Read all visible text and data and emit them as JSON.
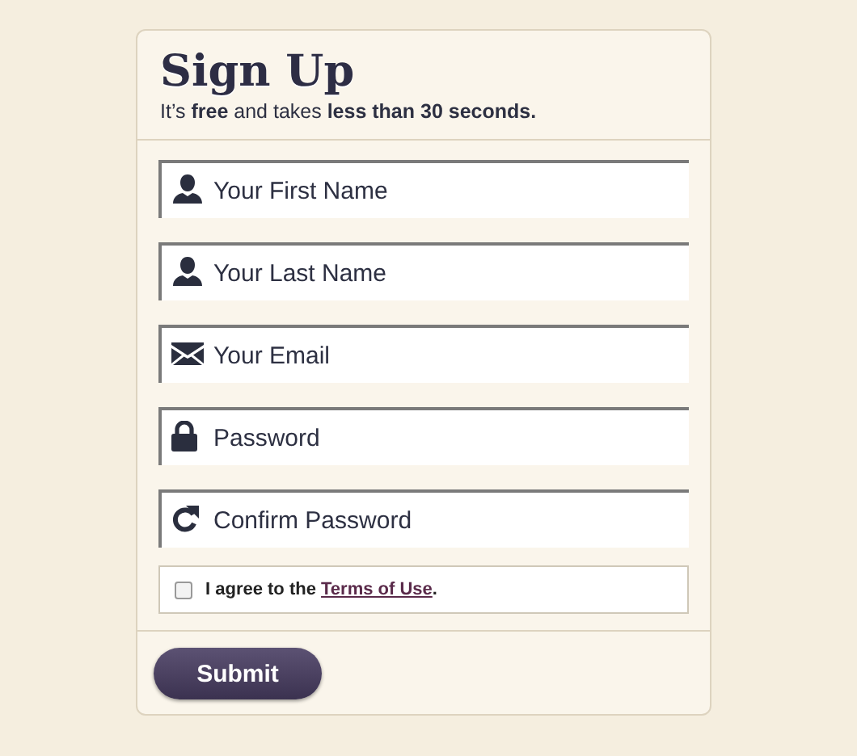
{
  "form": {
    "title": "Sign Up",
    "subtitle": "It’s **free** and takes **less than 30 seconds.**",
    "fields": [
      {
        "kind": "person",
        "placeholder": "Your First Name"
      },
      {
        "kind": "person",
        "placeholder": "Your Last Name"
      },
      {
        "kind": "mail",
        "placeholder": "Your Email"
      },
      {
        "kind": "lock",
        "placeholder": "Password"
      },
      {
        "kind": "refresh",
        "placeholder": "Confirm Password"
      }
    ],
    "agreement": {
      "checked": false,
      "text": "I agree to the ",
      "link": "Terms of Use",
      "after": "."
    },
    "submit": "Submit"
  }
}
